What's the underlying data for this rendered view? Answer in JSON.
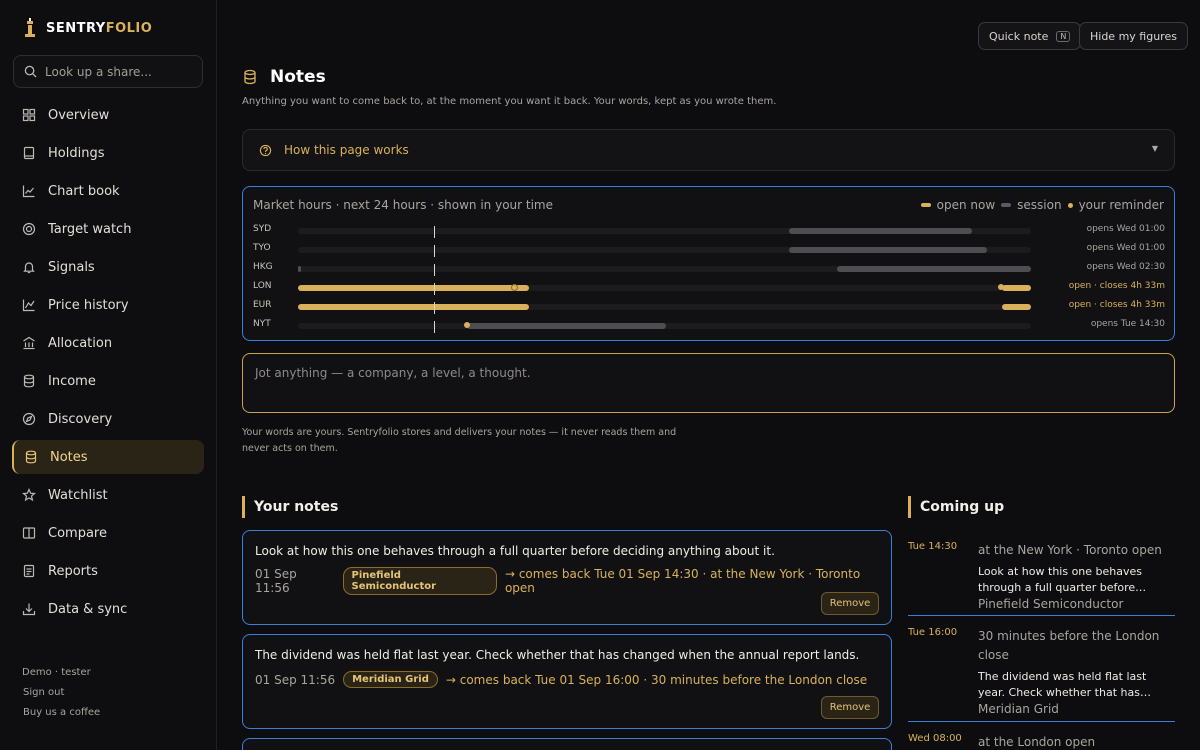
{
  "brand": {
    "prefix": "SENTRY",
    "suffix": "FOLIO"
  },
  "search": {
    "placeholder": "Look up a share..."
  },
  "nav": [
    {
      "label": "Overview",
      "icon": "grid-icon"
    },
    {
      "label": "Holdings",
      "icon": "book-icon"
    },
    {
      "label": "Chart book",
      "icon": "chart-line-icon"
    },
    {
      "label": "Target watch",
      "icon": "target-icon"
    },
    {
      "label": "Signals",
      "icon": "bell-icon"
    },
    {
      "label": "Price history",
      "icon": "trend-icon"
    },
    {
      "label": "Allocation",
      "icon": "bank-icon"
    },
    {
      "label": "Income",
      "icon": "database-icon"
    },
    {
      "label": "Discovery",
      "icon": "compass-icon"
    },
    {
      "label": "Notes",
      "icon": "database-icon",
      "active": true
    },
    {
      "label": "Watchlist",
      "icon": "star-icon"
    },
    {
      "label": "Compare",
      "icon": "columns-icon"
    },
    {
      "label": "Reports",
      "icon": "report-icon"
    },
    {
      "label": "Data & sync",
      "icon": "download-icon"
    }
  ],
  "footer": {
    "user": "Demo · tester",
    "sign_out": "Sign out",
    "coffee": "Buy us a coffee"
  },
  "top": {
    "quick_note": "Quick note",
    "quick_note_key": "N",
    "hide_figures": "Hide my figures"
  },
  "page": {
    "title": "Notes",
    "subtitle": "Anything you want to come back to, at the moment you want it back. Your words, kept as you wrote them."
  },
  "howto": {
    "label": "How this page works"
  },
  "market": {
    "title": "Market hours · next 24 hours · shown in your time",
    "legend": {
      "open": "open now",
      "session": "session",
      "reminder": "your reminder"
    },
    "rows": [
      {
        "code": "SYD",
        "status": "opens Wed 01:00",
        "is_open": false,
        "open": [],
        "session": [
          [
            0.67,
            0.92
          ]
        ],
        "reminders": []
      },
      {
        "code": "TYO",
        "status": "opens Wed 01:00",
        "is_open": false,
        "open": [],
        "session": [
          [
            0.67,
            0.94
          ]
        ],
        "reminders": []
      },
      {
        "code": "HKG",
        "status": "opens Wed 02:30",
        "is_open": false,
        "open": [],
        "session": [
          [
            0.0,
            0.004
          ],
          [
            0.735,
            1.0
          ]
        ],
        "reminders": []
      },
      {
        "code": "LON",
        "status": "open · closes 4h 33m",
        "is_open": true,
        "open": [
          [
            0.0,
            0.315
          ],
          [
            0.96,
            1.0
          ]
        ],
        "session": [],
        "reminders": [
          {
            "at": 0.295,
            "hollow": true
          },
          {
            "at": 0.959,
            "hollow": false
          }
        ]
      },
      {
        "code": "EUR",
        "status": "open · closes 4h 33m",
        "is_open": true,
        "open": [
          [
            0.0,
            0.315
          ],
          [
            0.96,
            1.0
          ]
        ],
        "session": [],
        "reminders": []
      },
      {
        "code": "NYT",
        "status": "opens Tue 14:30",
        "is_open": false,
        "open": [],
        "session": [
          [
            0.23,
            0.502
          ]
        ],
        "reminders": [
          {
            "at": 0.23,
            "hollow": false
          }
        ]
      }
    ]
  },
  "composer": {
    "placeholder": "Jot anything — a company, a level, a thought."
  },
  "privacy": "Your words are yours. Sentryfolio stores and delivers your notes — it never reads them and never acts on them.",
  "your_notes": {
    "title": "Your notes",
    "remove_label": "Remove",
    "items": [
      {
        "text": "Look at how this one behaves through a full quarter before deciding anything about it.",
        "date": "01 Sep 11:56",
        "tag": "Pinefield Semiconductor",
        "comes_back": "→ comes back Tue 01 Sep 14:30 · at the New York · Toronto open"
      },
      {
        "text": "The dividend was held flat last year. Check whether that has changed when the annual report lands.",
        "date": "01 Sep 11:56",
        "tag": "Meridian Grid",
        "comes_back": "→ comes back Tue 01 Sep 16:00 · 30 minutes before the London close"
      }
    ]
  },
  "coming_up": {
    "title": "Coming up",
    "items": [
      {
        "time": "Tue 14:30",
        "where": "at the New York · Toronto open",
        "text": "Look at how this one behaves through a full quarter before deciding anything about it.",
        "company": "Pinefield Semiconductor"
      },
      {
        "time": "Tue 16:00",
        "where": "30 minutes before the London close",
        "text": "The dividend was held flat last year. Check whether that has changed when the annual report lands.",
        "company": "Meridian Grid"
      },
      {
        "time": "Wed 08:00",
        "where": "at the London open",
        "text": "",
        "company": ""
      }
    ]
  },
  "colors": {
    "accent": "#d9b15a",
    "focus": "#3c7ed8",
    "bg": "#0d0d0f"
  }
}
